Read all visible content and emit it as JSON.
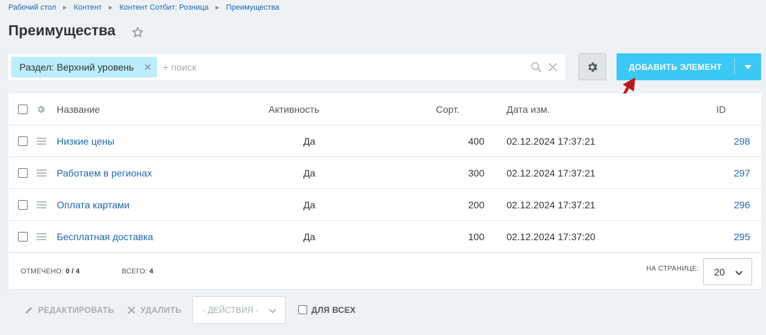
{
  "breadcrumbs": [
    "Рабочий стол",
    "Контент",
    "Контент Сотбит: Розница",
    "Преимущества"
  ],
  "title": "Преимущества",
  "filter": {
    "tag": "Раздел: Верхний уровень",
    "placeholder": "+ поиск"
  },
  "add_button": {
    "label": "ДОБАВИТЬ ЭЛЕМЕНТ"
  },
  "grid": {
    "columns": {
      "name": "Название",
      "active": "Активность",
      "sort": "Сорт.",
      "date": "Дата изм.",
      "id": "ID"
    },
    "rows": [
      {
        "name": "Низкие цены",
        "active": "Да",
        "sort": "400",
        "date": "02.12.2024 17:37:21",
        "id": "298"
      },
      {
        "name": "Работаем в регионах",
        "active": "Да",
        "sort": "300",
        "date": "02.12.2024 17:37:21",
        "id": "297"
      },
      {
        "name": "Оплата картами",
        "active": "Да",
        "sort": "200",
        "date": "02.12.2024 17:37:21",
        "id": "296"
      },
      {
        "name": "Бесплатная доставка",
        "active": "Да",
        "sort": "100",
        "date": "02.12.2024 17:37:20",
        "id": "295"
      }
    ]
  },
  "footer": {
    "selected_label": "ОТМЕЧЕНО:",
    "selected_value": "0 / 4",
    "total_label": "ВСЕГО:",
    "total_value": "4",
    "per_page_label": "НА СТРАНИЦЕ:",
    "per_page_value": "20"
  },
  "actions": {
    "edit": "РЕДАКТИРОВАТЬ",
    "delete": "УДАЛИТЬ",
    "select": "- ДЕЙСТВИЯ -",
    "for_all": "ДЛЯ ВСЕХ"
  },
  "colors": {
    "accent": "#3bc8f5",
    "link": "#2067b0",
    "tag_bg": "#bcedfc",
    "annotation_arrow": "#c0141b"
  }
}
